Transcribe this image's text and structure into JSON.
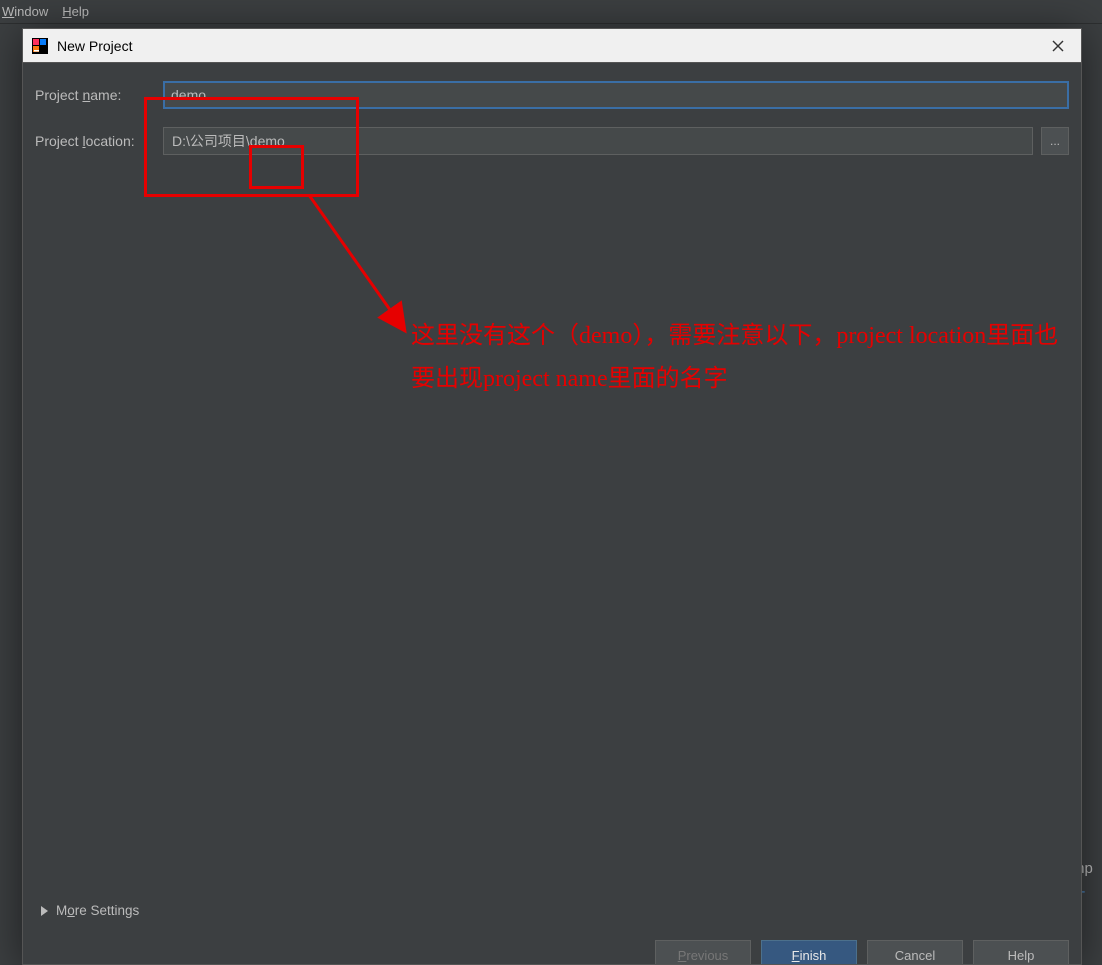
{
  "parent_window": {
    "menu_window": "Window",
    "menu_help": "Help"
  },
  "dialog": {
    "title": "New Project"
  },
  "form": {
    "name_label": "Project name:",
    "name_value": "demo",
    "location_label": "Project location:",
    "location_value": "D:\\公司项目\\demo",
    "browse_label": "..."
  },
  "annotation": {
    "text": "这里没有这个（demo），需要注意以下，project location里面也要出现project name里面的名字"
  },
  "more_settings_label": "More Settings",
  "buttons": {
    "previous": "Previous",
    "finish": "Finish",
    "cancel": "Cancel",
    "help": "Help"
  },
  "bg_fragments": {
    "mp": "mp",
    "o": "o-"
  }
}
